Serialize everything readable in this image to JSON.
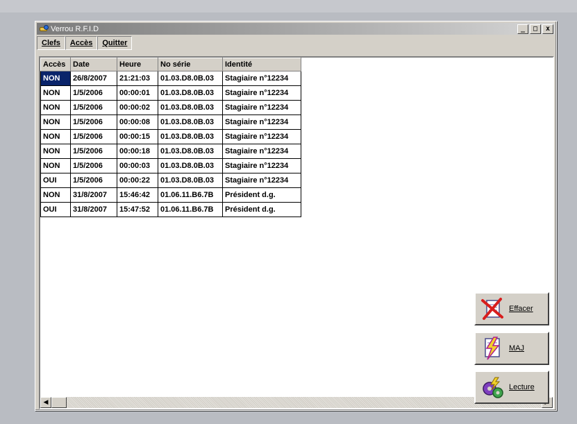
{
  "window": {
    "title": "Verrou R.F.I.D",
    "min_glyph": "_",
    "max_glyph": "□",
    "close_glyph": "x"
  },
  "menu": {
    "items": [
      {
        "label": "Clefs"
      },
      {
        "label": "Accès"
      },
      {
        "label": "Quitter"
      }
    ]
  },
  "table": {
    "columns": [
      "Accès",
      "Date",
      "Heure",
      "No série",
      "Identité"
    ],
    "rows": [
      [
        "NON",
        "26/8/2007",
        "21:21:03",
        "01.03.D8.0B.03",
        "Stagiaire n°12234"
      ],
      [
        "NON",
        "1/5/2006",
        "00:00:01",
        "01.03.D8.0B.03",
        "Stagiaire n°12234"
      ],
      [
        "NON",
        "1/5/2006",
        "00:00:02",
        "01.03.D8.0B.03",
        "Stagiaire n°12234"
      ],
      [
        "NON",
        "1/5/2006",
        "00:00:08",
        "01.03.D8.0B.03",
        "Stagiaire n°12234"
      ],
      [
        "NON",
        "1/5/2006",
        "00:00:15",
        "01.03.D8.0B.03",
        "Stagiaire n°12234"
      ],
      [
        "NON",
        "1/5/2006",
        "00:00:18",
        "01.03.D8.0B.03",
        "Stagiaire n°12234"
      ],
      [
        "NON",
        "1/5/2006",
        "00:00:03",
        "01.03.D8.0B.03",
        "Stagiaire n°12234"
      ],
      [
        "OUI",
        "1/5/2006",
        "00:00:22",
        "01.03.D8.0B.03",
        "Stagiaire n°12234"
      ],
      [
        "NON",
        "31/8/2007",
        "15:46:42",
        "01.06.11.B6.7B",
        "Président d.g."
      ],
      [
        "OUI",
        "31/8/2007",
        "15:47:52",
        "01.06.11.B6.7B",
        "Président d.g."
      ]
    ]
  },
  "buttons": {
    "effacer": "Effacer",
    "maj": "MAJ",
    "lecture": "Lecture"
  },
  "colors": {
    "selection": "#0a246a",
    "face": "#d4d0c8"
  },
  "icons": {
    "effacer": "delete-x-icon",
    "maj": "update-lightning-icon",
    "lecture": "read-gears-icon"
  }
}
